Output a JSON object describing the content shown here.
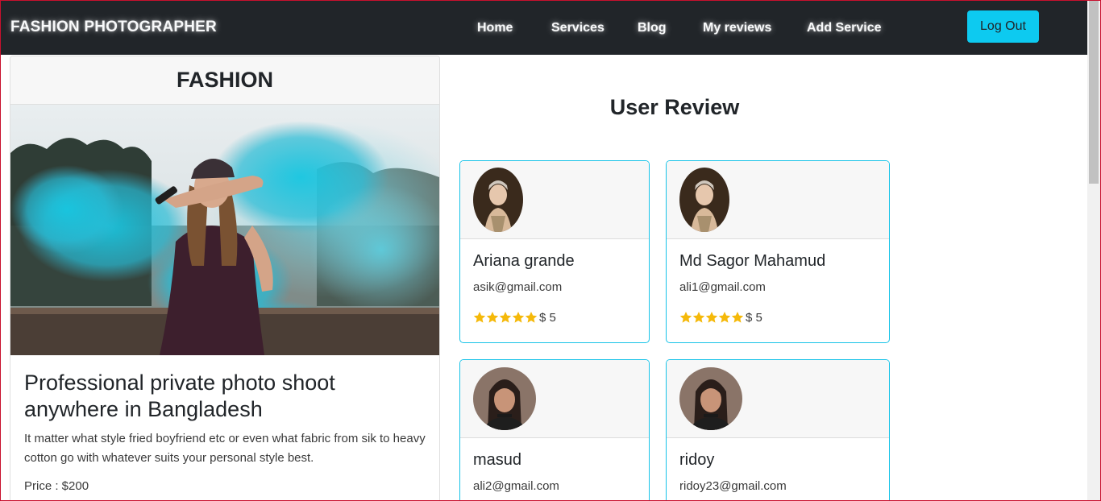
{
  "navbar": {
    "brand": "FASHION PHOTOGRAPHER",
    "links": [
      "Home",
      "Services",
      "Blog",
      "My reviews",
      "Add Service"
    ],
    "logout_label": "Log Out"
  },
  "service": {
    "category": "FASHION",
    "heading": "Professional private photo shoot anywhere in Bangladesh",
    "description": "It matter what style fried boyfriend etc or even what fabric from sik to heavy cotton go with whatever suits your personal style best.",
    "price": "Price : $200"
  },
  "reviews": {
    "title": "User Review",
    "items": [
      {
        "name": "Ariana grande",
        "email": "asik@gmail.com",
        "rating": "$ 5",
        "stars": 5
      },
      {
        "name": "Md Sagor Mahamud",
        "email": "ali1@gmail.com",
        "rating": "$ 5",
        "stars": 5
      },
      {
        "name": "masud",
        "email": "ali2@gmail.com",
        "rating": "",
        "stars": 0
      },
      {
        "name": "ridoy",
        "email": "ridoy23@gmail.com",
        "rating": "",
        "stars": 0
      }
    ]
  },
  "colors": {
    "navbar_bg": "#212529",
    "accent": "#0dcaf0",
    "card_border": "#17c3e8",
    "star": "#f5b90a"
  }
}
